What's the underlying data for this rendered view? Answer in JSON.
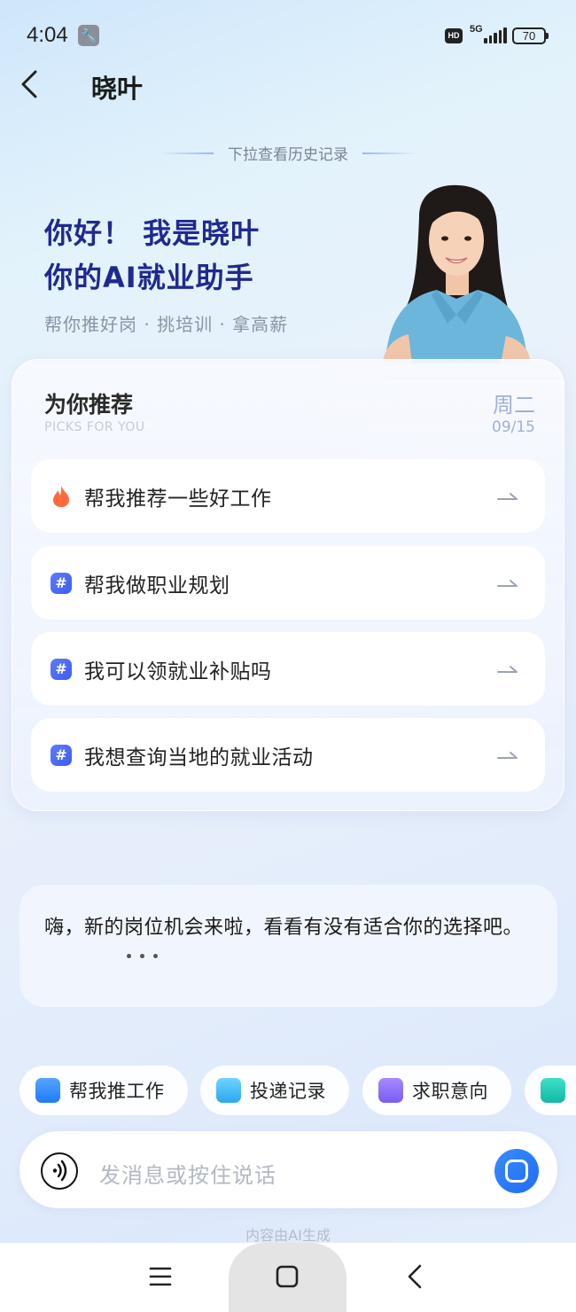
{
  "status_bar": {
    "time": "4:04",
    "network": "5G",
    "hd": "HD",
    "battery": "70"
  },
  "header": {
    "title": "晓叶"
  },
  "pull_hint": "下拉查看历史记录",
  "greeting": {
    "line1": "你好！ 我是晓叶",
    "line2": "你的AI就业助手",
    "slogan": "帮你推好岗 · 挑培训 · 拿高薪"
  },
  "recommend": {
    "title": "为你推荐",
    "subtitle": "PICKS FOR YOU",
    "weekday": "周二",
    "date": "09/15",
    "items": [
      {
        "label": "帮我推荐一些好工作",
        "icon": "fire-icon"
      },
      {
        "label": "帮我做职业规划",
        "icon": "hashtag-icon"
      },
      {
        "label": "我可以领就业补贴吗",
        "icon": "hashtag-icon"
      },
      {
        "label": "我想查询当地的就业活动",
        "icon": "hashtag-icon"
      }
    ]
  },
  "message": {
    "text": "嗨，新的岗位机会来啦，看看有没有适合你的选择吧。"
  },
  "chips": [
    {
      "label": "帮我推工作",
      "icon": "briefcase-icon",
      "color": "#2f8bff"
    },
    {
      "label": "投递记录",
      "icon": "mail-icon",
      "color": "#2fb6f0"
    },
    {
      "label": "求职意向",
      "icon": "doc-icon",
      "color": "#8a6cf2"
    },
    {
      "label": "",
      "icon": "list-icon",
      "color": "#1fc7b4"
    }
  ],
  "input": {
    "placeholder": "发消息或按住说话"
  },
  "ai_note": "内容由AI生成"
}
